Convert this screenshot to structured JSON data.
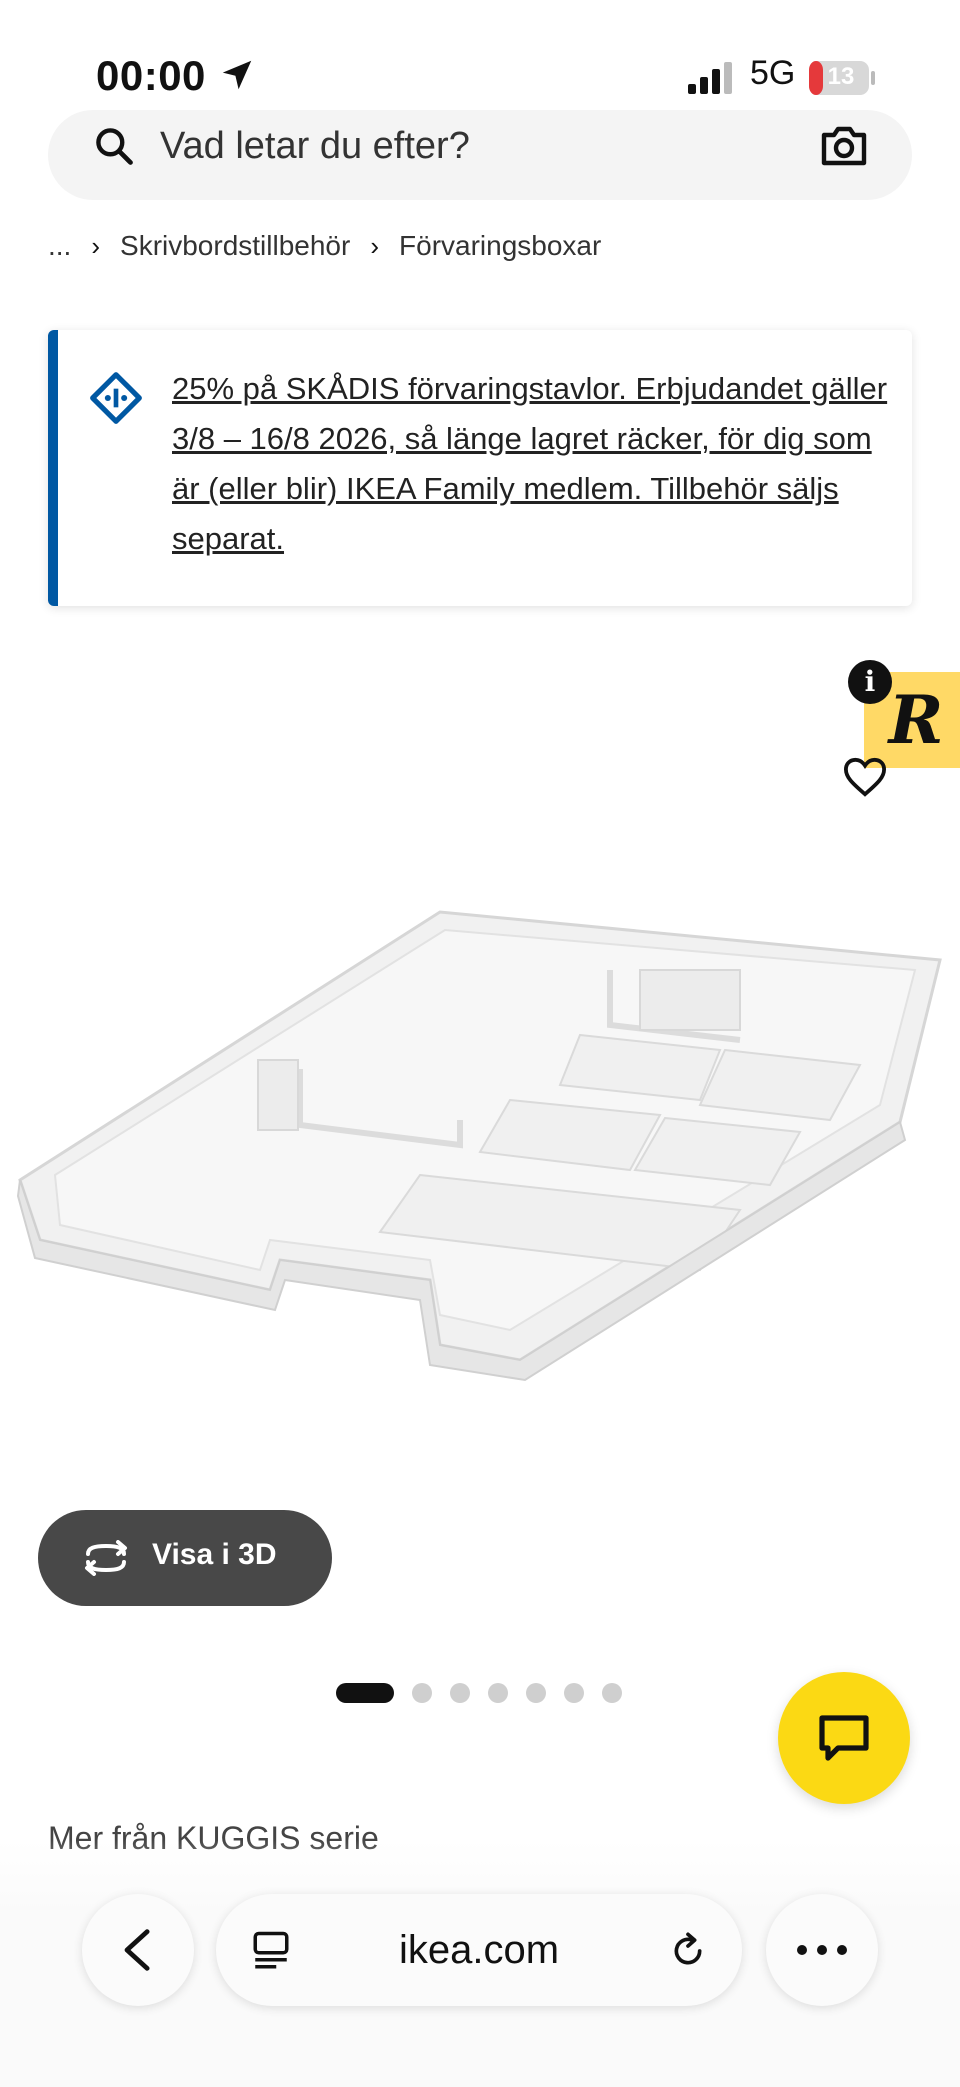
{
  "status_bar": {
    "time": "00:00",
    "network": "5G",
    "battery_level": "13"
  },
  "search": {
    "placeholder": "Vad letar du efter?",
    "value": ""
  },
  "breadcrumb": {
    "ellipsis": "...",
    "items": [
      "Skrivbordstillbehör",
      "Förvaringsboxar"
    ]
  },
  "promo": {
    "text": "25% på SKÅDIS förvaringstavlor. Erbjudandet gäller 3/8 – 16/8 2026, så länge lagret räcker, för dig som är (eller blir) IKEA Family medlem. Tillbehör säljs separat.",
    "accent_color": "#0058a3"
  },
  "rewards": {
    "letter": "R",
    "info": "i",
    "color": "#ffd966"
  },
  "product": {
    "icon": "drawer-insert-tray-image"
  },
  "view_3d": {
    "label": "Visa i 3D"
  },
  "carousel": {
    "total": 7,
    "active": 1
  },
  "series": {
    "label": "Mer från KUGGIS serie"
  },
  "browser": {
    "url": "ikea.com"
  },
  "colors": {
    "chat_fab": "#fbd914",
    "button_dark": "#484848"
  }
}
